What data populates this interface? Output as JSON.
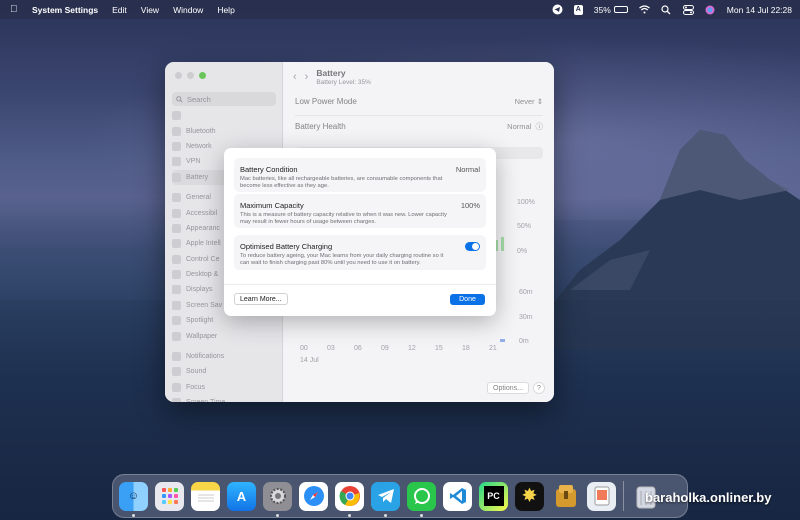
{
  "menubar": {
    "app_name": "System Settings",
    "menus": [
      "Edit",
      "View",
      "Window",
      "Help"
    ],
    "status_letter": "A",
    "battery_percent": "35%",
    "clock": "Mon 14 Jul  22:28"
  },
  "window": {
    "search_placeholder": "Search",
    "sidebar": [
      {
        "label": "",
        "icon": "generic-icon"
      },
      {
        "label": "Bluetooth",
        "icon": "bluetooth-icon"
      },
      {
        "label": "Network",
        "icon": "network-icon"
      },
      {
        "label": "VPN",
        "icon": "vpn-icon"
      },
      {
        "label": "Battery",
        "icon": "battery-icon"
      },
      {
        "label": "General",
        "icon": "gear-icon"
      },
      {
        "label": "Accessibil",
        "icon": "accessibility-icon"
      },
      {
        "label": "Appearanc",
        "icon": "appearance-icon"
      },
      {
        "label": "Apple Intell",
        "icon": "apple-intelligence-icon"
      },
      {
        "label": "Control Ce",
        "icon": "control-centre-icon"
      },
      {
        "label": "Desktop &",
        "icon": "desktop-icon"
      },
      {
        "label": "Displays",
        "icon": "display-icon"
      },
      {
        "label": "Screen Sav",
        "icon": "screensaver-icon"
      },
      {
        "label": "Spotlight",
        "icon": "spotlight-icon"
      },
      {
        "label": "Wallpaper",
        "icon": "wallpaper-icon"
      },
      {
        "label": "Notifications",
        "icon": "bell-icon"
      },
      {
        "label": "Sound",
        "icon": "speaker-icon"
      },
      {
        "label": "Focus",
        "icon": "moon-icon"
      },
      {
        "label": "Screen Time",
        "icon": "hourglass-icon"
      }
    ],
    "title": "Battery",
    "subtitle": "Battery Level: 35%",
    "low_power_label": "Low Power Mode",
    "low_power_value": "Never",
    "health_label": "Battery Health",
    "health_value": "Normal",
    "level_ticks": [
      "100%",
      "50%",
      "0%"
    ],
    "usage_ticks": [
      "60m",
      "30m",
      "0m"
    ],
    "hour_ticks": [
      "00",
      "03",
      "06",
      "09",
      "12",
      "15",
      "18",
      "21"
    ],
    "date_label": "14 Jul",
    "options_label": "Options...",
    "help_label": "?"
  },
  "modal": {
    "condition_title": "Battery Condition",
    "condition_value": "Normal",
    "condition_desc": "Mac batteries, like all rechargeable batteries, are consumable components that become less effective as they age.",
    "capacity_title": "Maximum Capacity",
    "capacity_value": "100%",
    "capacity_desc": "This is a measure of battery capacity relative to when it was new. Lower capacity may result in fewer hours of usage between charges.",
    "optimised_title": "Optimised Battery Charging",
    "optimised_on": true,
    "optimised_desc": "To reduce battery ageing, your Mac learns from your daily charging routine so it can wait to finish charging past 80% until you need to use it on battery.",
    "learn_more_label": "Learn More...",
    "done_label": "Done"
  },
  "dock": {
    "apps": [
      "Finder",
      "Launchpad",
      "Notes",
      "App Store",
      "System Settings",
      "Safari",
      "Chrome",
      "Telegram",
      "WhatsApp",
      "VS Code",
      "PyCharm",
      "Terminal",
      "Archive Utility",
      "Preview",
      "Trash"
    ]
  },
  "watermark": "baraholka.onliner.by",
  "colors": {
    "accent": "#0a72e6",
    "toggle": "#0a72e6"
  }
}
